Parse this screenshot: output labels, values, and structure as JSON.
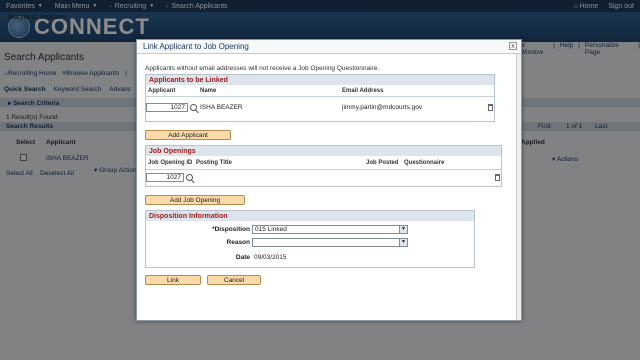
{
  "topnav": {
    "favorites": "Favorites",
    "main_menu": "Main Menu",
    "recruiting": "Recruiting",
    "search_applicants": "Search Applicants",
    "home": "Home",
    "sign_out": "Sign out"
  },
  "header": {
    "logo_word": "CONNECT",
    "logo_sub": "Maryland Judiciary"
  },
  "background": {
    "page_title": "Search Applicants",
    "links": [
      "Recruiting Home",
      "Browse Applicants",
      "|"
    ],
    "right_links": [
      "w Window",
      "|",
      "Help",
      "|",
      "Personalize Page",
      "|"
    ],
    "tabs": [
      "Quick Search",
      "Keyword Search",
      "Advanc"
    ],
    "search_criteria": "Search Criteria",
    "results_found": "1 Result(s) Found",
    "search_results": "Search Results",
    "pager": [
      "First",
      "1 of 1",
      "Last"
    ],
    "col_select": "Select",
    "col_applicant": "Applicant",
    "col_applied": "Applied",
    "row_applicant": "ISHA BEAZER",
    "row_actions": "Actions",
    "select_all": "Select All",
    "deselect_all": "Deselect All",
    "group_actions": "Group Actions"
  },
  "modal": {
    "title": "Link Applicant to Job Opening",
    "close": "x",
    "note": "Applicants without email addresses will not receive a Job Opening Questionnaire.",
    "applicants": {
      "header": "Applicants to be Linked",
      "col_applicant": "Applicant",
      "col_name": "Name",
      "col_email": "Email Address",
      "applicant_id": "1027",
      "name": "ISHA BEAZER",
      "email": "jimmy.partin@mdcourts.gov",
      "add_button": "Add Applicant"
    },
    "jobs": {
      "header": "Job Openings",
      "col_id": "Job Opening ID",
      "col_title": "Posting Title",
      "col_posted": "Job Posted",
      "col_questionnaire": "Questionnaire",
      "job_id": "1027",
      "add_button": "Add Job Opening"
    },
    "disposition": {
      "header": "Disposition Information",
      "disposition_label": "*Disposition",
      "disposition_value": "015 Linked",
      "reason_label": "Reason",
      "reason_value": "",
      "date_label": "Date",
      "date_value": "09/03/2015"
    },
    "link_button": "Link",
    "cancel_button": "Cancel"
  }
}
